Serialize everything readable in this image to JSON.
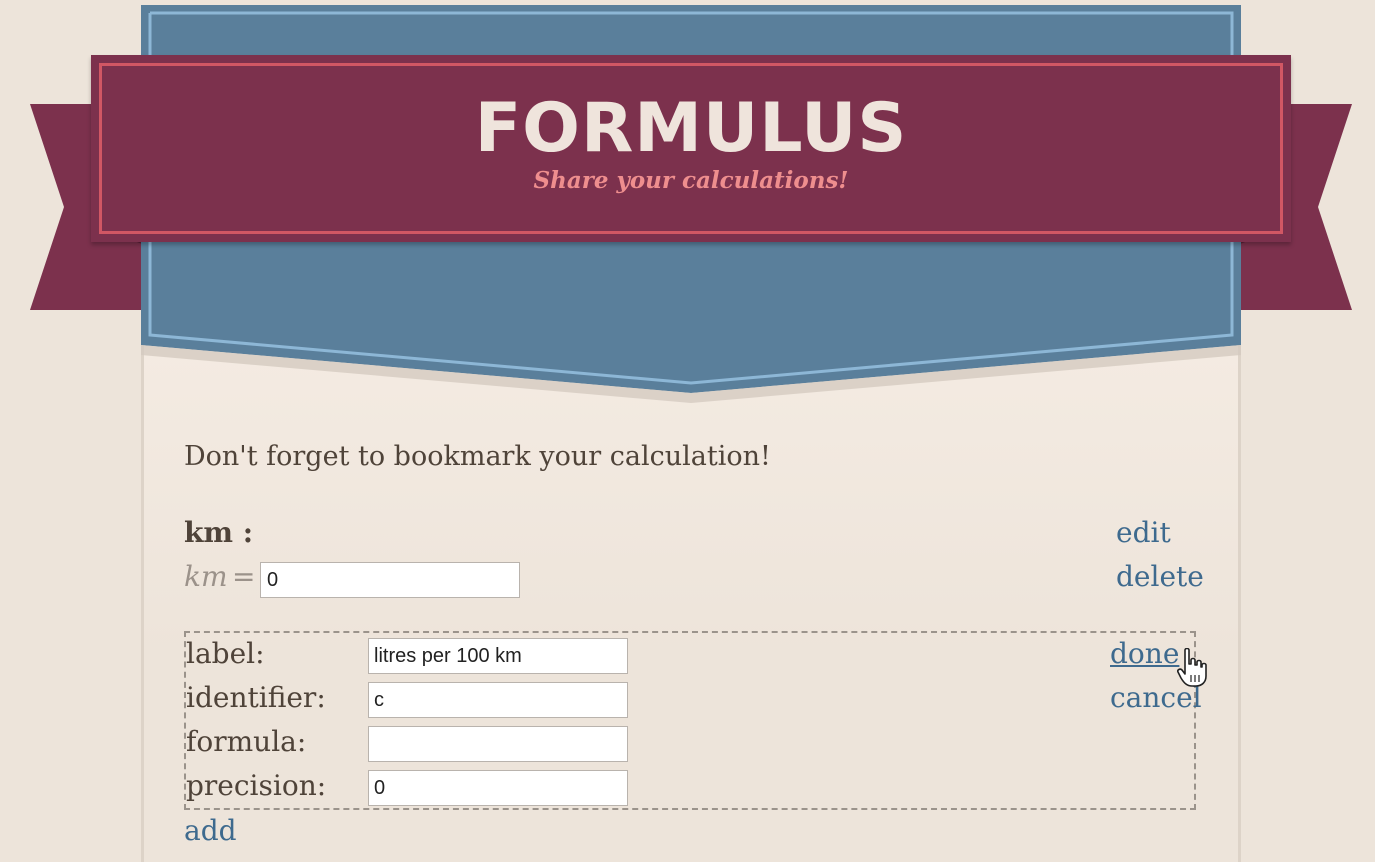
{
  "brand": {
    "title": "FORMULUS",
    "tagline": "Share your calculations!"
  },
  "colors": {
    "maroon": "#7c314d",
    "maroon_border": "#d15764",
    "blue": "#5a7f9b",
    "blue_border": "#8db7d6",
    "link": "#3e6a8e",
    "background": "#ede4da"
  },
  "reminder": "Don't forget to bookmark your calculation!",
  "field": {
    "title": "km :",
    "identifier": "km",
    "equals": "=",
    "value": "0",
    "edit_label": "edit",
    "delete_label": "delete"
  },
  "editor": {
    "label_label": "label:",
    "label_value": "litres per 100 km",
    "identifier_label": "identifier:",
    "identifier_value": "c",
    "formula_label": "formula:",
    "formula_value": "",
    "precision_label": "precision:",
    "precision_value": "0",
    "done_label": "done",
    "cancel_label": "cancel"
  },
  "add_label": "add",
  "icons": {
    "cursor": "hand-pointer-icon"
  }
}
